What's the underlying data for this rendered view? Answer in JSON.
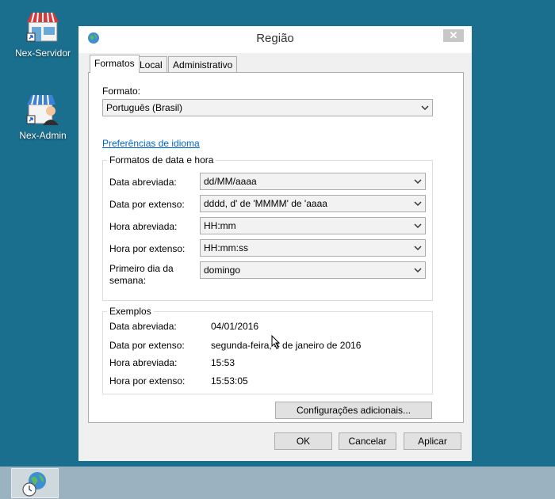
{
  "desktop": {
    "icons": [
      {
        "label": "Nex-Servidor",
        "icon": "shop-icon"
      },
      {
        "label": "Nex-Admin",
        "icon": "shop-admin-icon"
      }
    ]
  },
  "window": {
    "title": "Região",
    "close_glyph": "✕",
    "tabs": [
      "Formatos",
      "Local",
      "Administrativo"
    ],
    "active_tab": "Formatos"
  },
  "formats": {
    "format_label": "Formato:",
    "format_value": "Português (Brasil)",
    "language_prefs_link": "Preferências de idioma",
    "datetime_group_title": "Formatos de data e hora",
    "fields": [
      {
        "label": "Data abreviada:",
        "value": "dd/MM/aaaa"
      },
      {
        "label": "Data por extenso:",
        "value": "dddd, d' de 'MMMM' de 'aaaa"
      },
      {
        "label": "Hora abreviada:",
        "value": "HH:mm"
      },
      {
        "label": "Hora por extenso:",
        "value": "HH:mm:ss"
      },
      {
        "label_line1": "Primeiro dia da",
        "label_line2": "semana:",
        "value": "domingo"
      }
    ],
    "examples_title": "Exemplos",
    "examples": [
      {
        "label": "Data abreviada:",
        "value": "04/01/2016"
      },
      {
        "label": "Data por extenso:",
        "value": "segunda-feira, 4 de janeiro de 2016"
      },
      {
        "label": "Hora abreviada:",
        "value": "15:53"
      },
      {
        "label": "Hora por extenso:",
        "value": "15:53:05"
      }
    ],
    "additional_settings_button": "Configurações adicionais..."
  },
  "footer": {
    "ok": "OK",
    "cancel": "Cancelar",
    "apply": "Aplicar"
  },
  "colors": {
    "desktop": "#1a6e8e",
    "link": "#0066cc",
    "taskbar": "#9bb3c0"
  }
}
